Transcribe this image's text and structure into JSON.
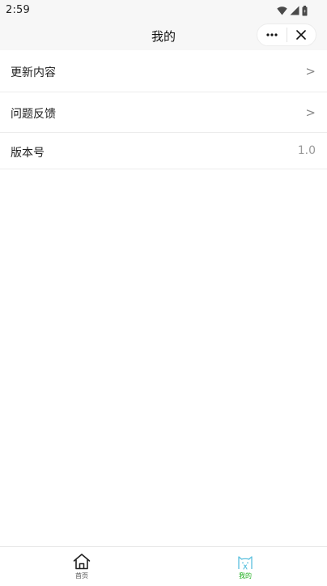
{
  "status_bar": {
    "time": "2:59",
    "icons": [
      "wifi-icon",
      "signal-icon",
      "battery-icon"
    ]
  },
  "nav_bar": {
    "title": "我的",
    "capsule": {
      "more_icon": "more-dots-icon",
      "close_icon": "close-icon"
    }
  },
  "menu": {
    "items": [
      {
        "label": "更新内容",
        "trailing": ">"
      },
      {
        "label": "问题反馈",
        "trailing": ">"
      },
      {
        "label": "版本号",
        "value": "1.0"
      }
    ]
  },
  "tab_bar": {
    "items": [
      {
        "label": "首页",
        "icon": "home-icon",
        "active": false
      },
      {
        "label": "我的",
        "icon": "cat-face-icon",
        "active": true
      }
    ],
    "active_color": "#1aad19",
    "inactive_color": "#555555"
  }
}
